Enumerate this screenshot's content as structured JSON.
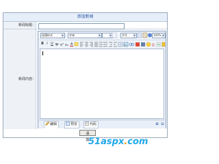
{
  "form": {
    "heading": "添加新闻",
    "title_label": "新闻标题：",
    "title_value": "",
    "content_label": "新闻内容："
  },
  "toolbar": {
    "paragraph_style": "段落样式",
    "font_name": "字体",
    "font_size": "字号",
    "zoom": "100%"
  },
  "modes": {
    "edit": "编辑",
    "preview": "预览",
    "code": "代码"
  },
  "submit_label": "添 加",
  "watermark": {
    "part1": "51aspx",
    "dot": ".",
    "part2": "com"
  },
  "colors": {
    "accent": "#2a56a8",
    "watermark_blue": "#22a8e8",
    "watermark_orange": "#f29a13"
  }
}
